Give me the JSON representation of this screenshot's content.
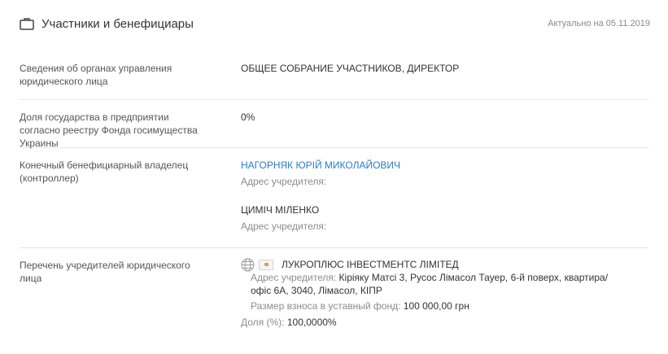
{
  "header": {
    "icon": "briefcase-icon",
    "title": "Участники и бенефициары",
    "actual": "Актуально на 05.11.2019"
  },
  "rows": {
    "governance": {
      "label": "Сведения об органах управления юридического лица",
      "value": "ОБЩЕЕ СОБРАНИЕ УЧАСТНИКОВ, ДИРЕКТОР"
    },
    "state_share": {
      "label": "Доля государства в предприятии согласно реестру Фонда госимущества Украины",
      "value": "0%"
    },
    "beneficiary": {
      "label": "Конечный бенефициарный владелец (контроллер)",
      "owners": [
        {
          "name": "НАГОРНЯК ЮРІЙ МИКОЛАЙОВИЧ",
          "address_label": "Адрес учредителя:",
          "address_value": ""
        },
        {
          "name": "ЦИМІЧ МІЛЕНКО",
          "address_label": "Адрес учредителя:",
          "address_value": ""
        }
      ]
    },
    "founders": {
      "label": "Перечень учредителей юридического лица",
      "founder": {
        "name": "ЛУКРОПЛЮС ІНВЕСТМЕНТС ЛІМІТЕД",
        "address_label": "Адрес учредителя:",
        "address_line1": "Кіріяку Матсі 3, Русос Лімасол Тауер, 6-й поверх, квартира/",
        "address_line2": "офіс 6А, 3040, Лімасол, КІПР",
        "contribution_label": "Размер взноса в уставный фонд:",
        "contribution_value": "100 000,00 грн",
        "share_label": "Доля (%):",
        "share_value": "100,0000%"
      }
    }
  },
  "colors": {
    "link": "#2a7cc7",
    "divider": "#e6e6e6",
    "muted": "#8c8c8c"
  },
  "icons": [
    "briefcase-icon",
    "globe-icon",
    "cyprus-flag-icon"
  ]
}
